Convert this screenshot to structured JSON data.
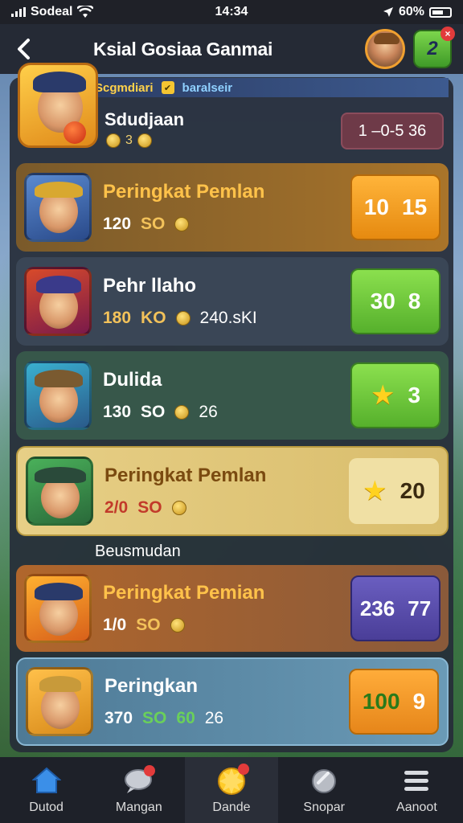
{
  "status_bar": {
    "carrier": "Sodeal",
    "time": "14:34",
    "battery": "60%"
  },
  "header": {
    "title": "Ksial Gosiaa Ganmai",
    "badge_text": "2",
    "badge_close": "×"
  },
  "hero": {
    "label_1": "Scgmdiari",
    "label_2": "baralseir",
    "name": "Sdudjaan",
    "coin_text": "3",
    "score": "1 –0-5 36"
  },
  "rows": [
    {
      "name": "Peringkat Pemlan",
      "stats": [
        "120",
        "SO"
      ],
      "score": [
        "10",
        "15"
      ]
    },
    {
      "name": "Pehr llaho",
      "stats": [
        "180",
        "KO",
        "240.sKI"
      ],
      "score": [
        "30",
        "8"
      ]
    },
    {
      "name": "Dulida",
      "stats": [
        "130",
        "SO",
        "26"
      ],
      "score": [
        "",
        "3"
      ]
    },
    {
      "name": "Peringkat Pemlan",
      "stats": [
        "2/0",
        "SO"
      ],
      "score": [
        "",
        "20"
      ]
    },
    {
      "name": "Peringkat Pemian",
      "stats": [
        "1/0",
        "SO"
      ],
      "score": [
        "236",
        "77"
      ]
    },
    {
      "name": "Peringkan",
      "stats": [
        "370",
        "SO",
        "60",
        "26"
      ],
      "score": [
        "100",
        "9"
      ]
    }
  ],
  "section_label": "Beusmudan",
  "nav": [
    {
      "label": "Dutod",
      "icon": "home-icon"
    },
    {
      "label": "Mangan",
      "icon": "chat-icon"
    },
    {
      "label": "Dande",
      "icon": "trophy-icon"
    },
    {
      "label": "Snopar",
      "icon": "shield-icon"
    },
    {
      "label": "Aanoot",
      "icon": "menu-icon"
    }
  ],
  "colors": {
    "row_1": "#b8781f",
    "row_2": "#3d4b5c",
    "row_3": "#3b5a4a",
    "row_4": "#e3c97a",
    "row_5": "#a66a34",
    "row_6": "#5a86a2",
    "score_orange": "#f09a1c",
    "score_green": "#6fc43c",
    "score_purple": "#5b4fa8",
    "score_light": "#f0e0a4"
  }
}
